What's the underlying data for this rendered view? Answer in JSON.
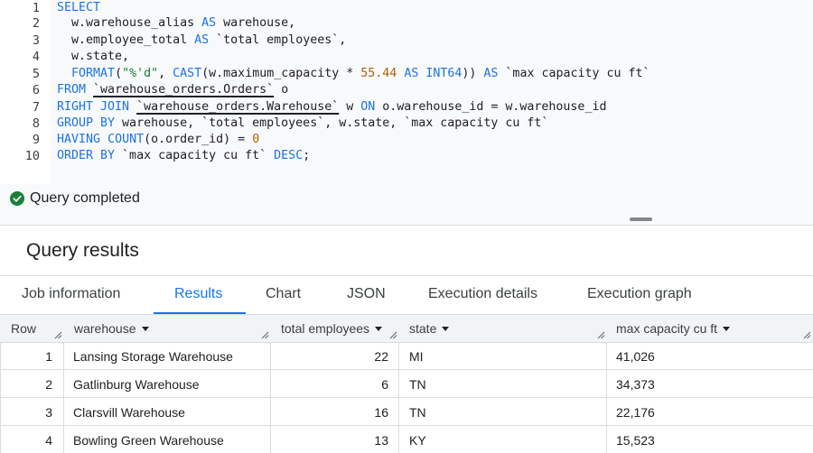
{
  "editor": {
    "line_numbers": [
      "1",
      "2",
      "3",
      "4",
      "5",
      "6",
      "7",
      "8",
      "9",
      "10"
    ],
    "lines": [
      [
        {
          "t": "SELECT",
          "c": "kw"
        }
      ],
      [
        {
          "t": "  w.warehouse_alias ",
          "c": ""
        },
        {
          "t": "AS",
          "c": "kw"
        },
        {
          "t": " warehouse,",
          "c": ""
        }
      ],
      [
        {
          "t": "  w.employee_total ",
          "c": ""
        },
        {
          "t": "AS",
          "c": "kw"
        },
        {
          "t": " `total employees`,",
          "c": ""
        }
      ],
      [
        {
          "t": "  w.state,",
          "c": ""
        }
      ],
      [
        {
          "t": "  ",
          "c": ""
        },
        {
          "t": "FORMAT",
          "c": "fn"
        },
        {
          "t": "(",
          "c": ""
        },
        {
          "t": "\"%'d\"",
          "c": "str"
        },
        {
          "t": ", ",
          "c": ""
        },
        {
          "t": "CAST",
          "c": "fn"
        },
        {
          "t": "(w.maximum_capacity * ",
          "c": ""
        },
        {
          "t": "55.44",
          "c": "num"
        },
        {
          "t": " ",
          "c": ""
        },
        {
          "t": "AS INT64",
          "c": "kw"
        },
        {
          "t": ")) ",
          "c": ""
        },
        {
          "t": "AS",
          "c": "kw"
        },
        {
          "t": " `max capacity cu ft`",
          "c": ""
        }
      ],
      [
        {
          "t": "FROM",
          "c": "kw"
        },
        {
          "t": " ",
          "c": ""
        },
        {
          "t": "`warehouse_orders.Orders`",
          "c": "tbl"
        },
        {
          "t": " o",
          "c": ""
        }
      ],
      [
        {
          "t": "RIGHT JOIN",
          "c": "kw"
        },
        {
          "t": " ",
          "c": ""
        },
        {
          "t": "`warehouse_orders.Warehouse`",
          "c": "tbl"
        },
        {
          "t": " w ",
          "c": ""
        },
        {
          "t": "ON",
          "c": "kw"
        },
        {
          "t": " o.warehouse_id = w.warehouse_id",
          "c": ""
        }
      ],
      [
        {
          "t": "GROUP BY",
          "c": "kw"
        },
        {
          "t": " warehouse, `total employees`, w.state, `max capacity cu ft`",
          "c": ""
        }
      ],
      [
        {
          "t": "HAVING",
          "c": "kw"
        },
        {
          "t": " ",
          "c": ""
        },
        {
          "t": "COUNT",
          "c": "fn"
        },
        {
          "t": "(o.order_id) = ",
          "c": ""
        },
        {
          "t": "0",
          "c": "num"
        }
      ],
      [
        {
          "t": "ORDER BY",
          "c": "kw"
        },
        {
          "t": " `max capacity cu ft` ",
          "c": ""
        },
        {
          "t": "DESC",
          "c": "kw"
        },
        {
          "t": ";",
          "c": ""
        }
      ]
    ]
  },
  "status": {
    "text": "Query completed",
    "icon": "check-circle-icon",
    "color": "#188038"
  },
  "results": {
    "title": "Query results",
    "tabs": [
      "Job information",
      "Results",
      "Chart",
      "JSON",
      "Execution details",
      "Execution graph"
    ],
    "active_tab": "Results"
  },
  "table": {
    "columns": [
      "Row",
      "warehouse",
      "total employees",
      "state",
      "max capacity cu ft"
    ],
    "rows": [
      [
        "1",
        "Lansing Storage Warehouse",
        "22",
        "MI",
        "41,026"
      ],
      [
        "2",
        "Gatlinburg Warehouse",
        "6",
        "TN",
        "34,373"
      ],
      [
        "3",
        "Clarsvill Warehouse",
        "16",
        "TN",
        "22,176"
      ],
      [
        "4",
        "Bowling Green Warehouse",
        "13",
        "KY",
        "15,523"
      ]
    ]
  },
  "colors": {
    "accent": "#1a73e8",
    "string": "#188038",
    "number": "#b06000"
  }
}
